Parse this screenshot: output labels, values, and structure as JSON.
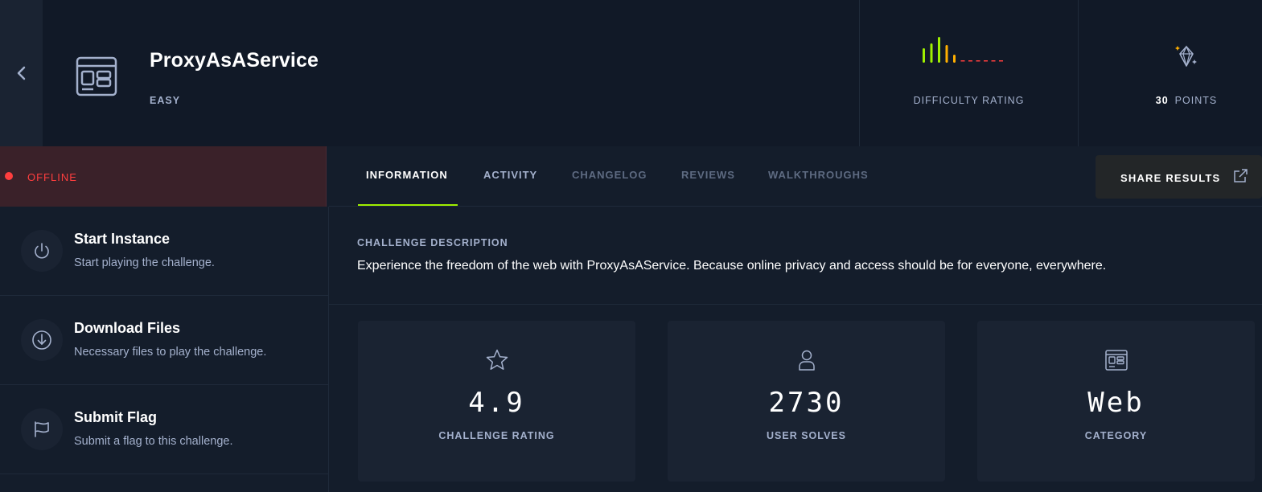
{
  "header": {
    "title": "ProxyAsAService",
    "difficulty": "EASY",
    "difficulty_rating_label": "DIFFICULTY RATING",
    "points_value": "30",
    "points_label": "POINTS",
    "difficulty_bars": {
      "filled": 5,
      "total": 11,
      "colors": [
        "#9fef00",
        "#9fef00",
        "#9fef00",
        "#ffaf00",
        "#ffaf00"
      ],
      "empty_color": "#ff3e3e"
    }
  },
  "status": {
    "text": "OFFLINE",
    "color": "#ff3e3e"
  },
  "actions": [
    {
      "title": "Start Instance",
      "desc": "Start playing the challenge.",
      "icon": "power-icon"
    },
    {
      "title": "Download Files",
      "desc": "Necessary files to play the challenge.",
      "icon": "download-icon"
    },
    {
      "title": "Submit Flag",
      "desc": "Submit a flag to this challenge.",
      "icon": "flag-icon"
    }
  ],
  "tabs": [
    {
      "label": "INFORMATION",
      "state": "active"
    },
    {
      "label": "ACTIVITY",
      "state": "enabled"
    },
    {
      "label": "CHANGELOG",
      "state": "disabled"
    },
    {
      "label": "REVIEWS",
      "state": "disabled"
    },
    {
      "label": "WALKTHROUGHS",
      "state": "disabled"
    }
  ],
  "share_label": "SHARE RESULTS",
  "description": {
    "label": "CHALLENGE DESCRIPTION",
    "text": "Experience the freedom of the web with ProxyAsAService. Because online privacy and access should be for everyone, everywhere."
  },
  "stats": [
    {
      "value": "4.9",
      "label": "CHALLENGE RATING",
      "icon": "star-icon"
    },
    {
      "value": "2730",
      "label": "USER SOLVES",
      "icon": "user-icon"
    },
    {
      "value": "Web",
      "label": "CATEGORY",
      "icon": "web-icon"
    }
  ],
  "colors": {
    "accent": "#9fef00",
    "background": "#141d2b",
    "header_background": "#111927",
    "card_background": "#1a2332",
    "offline_background": "#3a2129"
  }
}
